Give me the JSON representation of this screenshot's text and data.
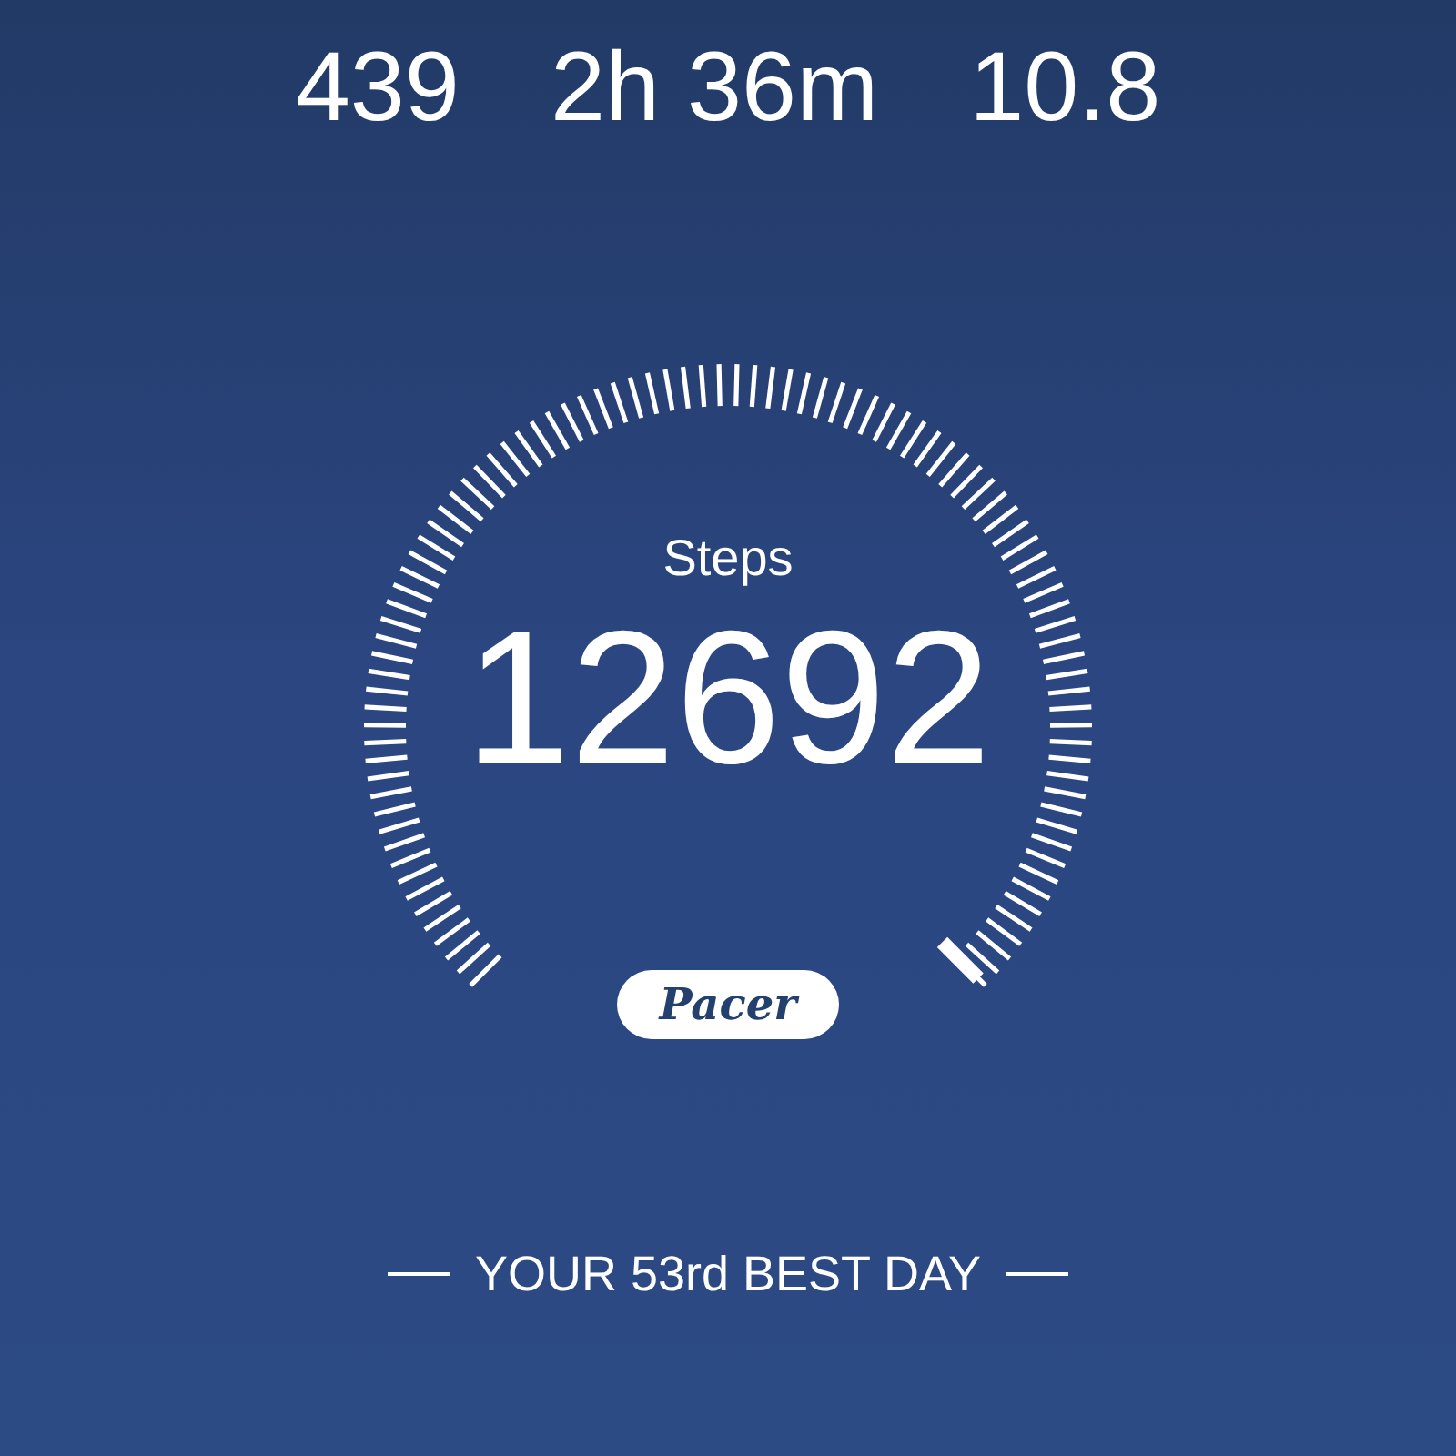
{
  "stats": [
    {
      "value": "439"
    },
    {
      "value": "2h 36m"
    },
    {
      "value": "10.8"
    }
  ],
  "dial": {
    "label": "Steps",
    "value": "12692",
    "logo": "Pacer"
  },
  "rank_text": "YOUR 53rd BEST DAY"
}
